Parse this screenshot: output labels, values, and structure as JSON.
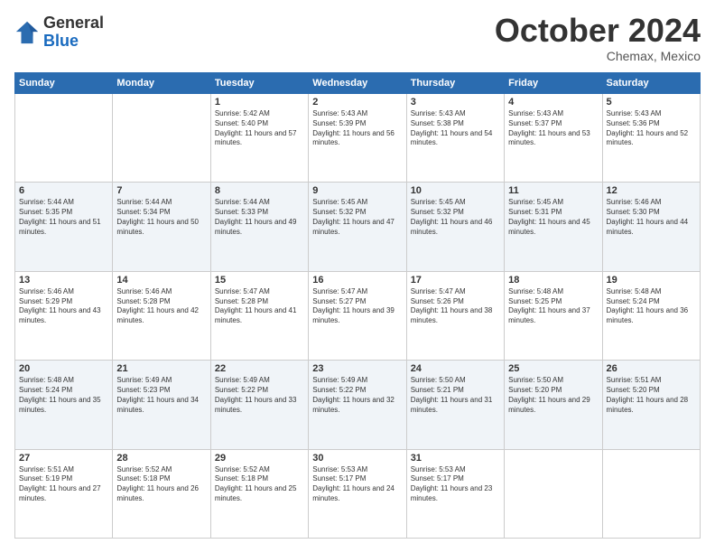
{
  "logo": {
    "general": "General",
    "blue": "Blue"
  },
  "title": "October 2024",
  "location": "Chemax, Mexico",
  "days_header": [
    "Sunday",
    "Monday",
    "Tuesday",
    "Wednesday",
    "Thursday",
    "Friday",
    "Saturday"
  ],
  "weeks": [
    [
      {
        "day": "",
        "sunrise": "",
        "sunset": "",
        "daylight": ""
      },
      {
        "day": "",
        "sunrise": "",
        "sunset": "",
        "daylight": ""
      },
      {
        "day": "1",
        "sunrise": "Sunrise: 5:42 AM",
        "sunset": "Sunset: 5:40 PM",
        "daylight": "Daylight: 11 hours and 57 minutes."
      },
      {
        "day": "2",
        "sunrise": "Sunrise: 5:43 AM",
        "sunset": "Sunset: 5:39 PM",
        "daylight": "Daylight: 11 hours and 56 minutes."
      },
      {
        "day": "3",
        "sunrise": "Sunrise: 5:43 AM",
        "sunset": "Sunset: 5:38 PM",
        "daylight": "Daylight: 11 hours and 54 minutes."
      },
      {
        "day": "4",
        "sunrise": "Sunrise: 5:43 AM",
        "sunset": "Sunset: 5:37 PM",
        "daylight": "Daylight: 11 hours and 53 minutes."
      },
      {
        "day": "5",
        "sunrise": "Sunrise: 5:43 AM",
        "sunset": "Sunset: 5:36 PM",
        "daylight": "Daylight: 11 hours and 52 minutes."
      }
    ],
    [
      {
        "day": "6",
        "sunrise": "Sunrise: 5:44 AM",
        "sunset": "Sunset: 5:35 PM",
        "daylight": "Daylight: 11 hours and 51 minutes."
      },
      {
        "day": "7",
        "sunrise": "Sunrise: 5:44 AM",
        "sunset": "Sunset: 5:34 PM",
        "daylight": "Daylight: 11 hours and 50 minutes."
      },
      {
        "day": "8",
        "sunrise": "Sunrise: 5:44 AM",
        "sunset": "Sunset: 5:33 PM",
        "daylight": "Daylight: 11 hours and 49 minutes."
      },
      {
        "day": "9",
        "sunrise": "Sunrise: 5:45 AM",
        "sunset": "Sunset: 5:32 PM",
        "daylight": "Daylight: 11 hours and 47 minutes."
      },
      {
        "day": "10",
        "sunrise": "Sunrise: 5:45 AM",
        "sunset": "Sunset: 5:32 PM",
        "daylight": "Daylight: 11 hours and 46 minutes."
      },
      {
        "day": "11",
        "sunrise": "Sunrise: 5:45 AM",
        "sunset": "Sunset: 5:31 PM",
        "daylight": "Daylight: 11 hours and 45 minutes."
      },
      {
        "day": "12",
        "sunrise": "Sunrise: 5:46 AM",
        "sunset": "Sunset: 5:30 PM",
        "daylight": "Daylight: 11 hours and 44 minutes."
      }
    ],
    [
      {
        "day": "13",
        "sunrise": "Sunrise: 5:46 AM",
        "sunset": "Sunset: 5:29 PM",
        "daylight": "Daylight: 11 hours and 43 minutes."
      },
      {
        "day": "14",
        "sunrise": "Sunrise: 5:46 AM",
        "sunset": "Sunset: 5:28 PM",
        "daylight": "Daylight: 11 hours and 42 minutes."
      },
      {
        "day": "15",
        "sunrise": "Sunrise: 5:47 AM",
        "sunset": "Sunset: 5:28 PM",
        "daylight": "Daylight: 11 hours and 41 minutes."
      },
      {
        "day": "16",
        "sunrise": "Sunrise: 5:47 AM",
        "sunset": "Sunset: 5:27 PM",
        "daylight": "Daylight: 11 hours and 39 minutes."
      },
      {
        "day": "17",
        "sunrise": "Sunrise: 5:47 AM",
        "sunset": "Sunset: 5:26 PM",
        "daylight": "Daylight: 11 hours and 38 minutes."
      },
      {
        "day": "18",
        "sunrise": "Sunrise: 5:48 AM",
        "sunset": "Sunset: 5:25 PM",
        "daylight": "Daylight: 11 hours and 37 minutes."
      },
      {
        "day": "19",
        "sunrise": "Sunrise: 5:48 AM",
        "sunset": "Sunset: 5:24 PM",
        "daylight": "Daylight: 11 hours and 36 minutes."
      }
    ],
    [
      {
        "day": "20",
        "sunrise": "Sunrise: 5:48 AM",
        "sunset": "Sunset: 5:24 PM",
        "daylight": "Daylight: 11 hours and 35 minutes."
      },
      {
        "day": "21",
        "sunrise": "Sunrise: 5:49 AM",
        "sunset": "Sunset: 5:23 PM",
        "daylight": "Daylight: 11 hours and 34 minutes."
      },
      {
        "day": "22",
        "sunrise": "Sunrise: 5:49 AM",
        "sunset": "Sunset: 5:22 PM",
        "daylight": "Daylight: 11 hours and 33 minutes."
      },
      {
        "day": "23",
        "sunrise": "Sunrise: 5:49 AM",
        "sunset": "Sunset: 5:22 PM",
        "daylight": "Daylight: 11 hours and 32 minutes."
      },
      {
        "day": "24",
        "sunrise": "Sunrise: 5:50 AM",
        "sunset": "Sunset: 5:21 PM",
        "daylight": "Daylight: 11 hours and 31 minutes."
      },
      {
        "day": "25",
        "sunrise": "Sunrise: 5:50 AM",
        "sunset": "Sunset: 5:20 PM",
        "daylight": "Daylight: 11 hours and 29 minutes."
      },
      {
        "day": "26",
        "sunrise": "Sunrise: 5:51 AM",
        "sunset": "Sunset: 5:20 PM",
        "daylight": "Daylight: 11 hours and 28 minutes."
      }
    ],
    [
      {
        "day": "27",
        "sunrise": "Sunrise: 5:51 AM",
        "sunset": "Sunset: 5:19 PM",
        "daylight": "Daylight: 11 hours and 27 minutes."
      },
      {
        "day": "28",
        "sunrise": "Sunrise: 5:52 AM",
        "sunset": "Sunset: 5:18 PM",
        "daylight": "Daylight: 11 hours and 26 minutes."
      },
      {
        "day": "29",
        "sunrise": "Sunrise: 5:52 AM",
        "sunset": "Sunset: 5:18 PM",
        "daylight": "Daylight: 11 hours and 25 minutes."
      },
      {
        "day": "30",
        "sunrise": "Sunrise: 5:53 AM",
        "sunset": "Sunset: 5:17 PM",
        "daylight": "Daylight: 11 hours and 24 minutes."
      },
      {
        "day": "31",
        "sunrise": "Sunrise: 5:53 AM",
        "sunset": "Sunset: 5:17 PM",
        "daylight": "Daylight: 11 hours and 23 minutes."
      },
      {
        "day": "",
        "sunrise": "",
        "sunset": "",
        "daylight": ""
      },
      {
        "day": "",
        "sunrise": "",
        "sunset": "",
        "daylight": ""
      }
    ]
  ]
}
